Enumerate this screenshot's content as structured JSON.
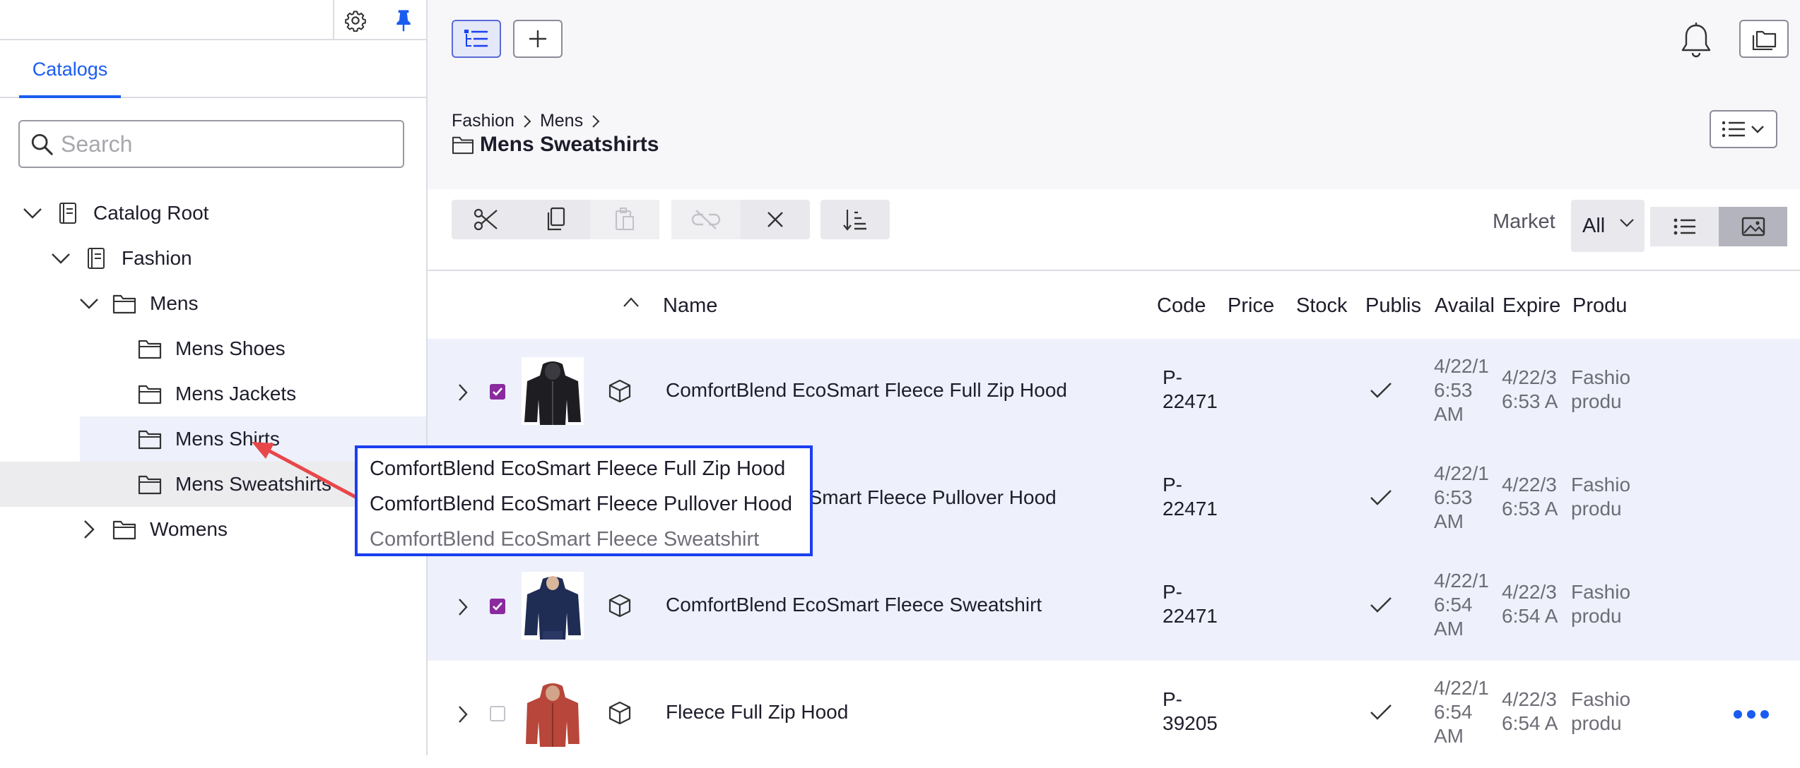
{
  "left_panel": {
    "tab_label": "Catalogs",
    "search_placeholder": "Search",
    "tree": [
      {
        "label": "Catalog Root",
        "expanded": true,
        "icon": "catalog-icon"
      },
      {
        "label": "Fashion",
        "expanded": true,
        "icon": "catalog-icon"
      },
      {
        "label": "Mens",
        "expanded": true,
        "icon": "folder-icon"
      },
      {
        "label": "Mens Shoes",
        "icon": "folder-icon"
      },
      {
        "label": "Mens Jackets",
        "icon": "folder-icon"
      },
      {
        "label": "Mens Shirts",
        "icon": "folder-icon"
      },
      {
        "label": "Mens Sweatshirts",
        "icon": "folder-icon"
      },
      {
        "label": "Womens",
        "expanded": false,
        "icon": "folder-icon"
      }
    ]
  },
  "breadcrumb": [
    "Fashion",
    "Mens"
  ],
  "page_title": "Mens Sweatshirts",
  "market": {
    "label": "Market",
    "value": "All"
  },
  "columns": [
    "Name",
    "Code",
    "Price",
    "Stock",
    "Publis",
    "Availal",
    "Expire",
    "Produ"
  ],
  "rows": [
    {
      "name": "ComfortBlend EcoSmart Fleece Full Zip Hood",
      "code": [
        "P-",
        "22471"
      ],
      "published": true,
      "available": [
        "4/22/1",
        "6:53",
        "AM"
      ],
      "expires": [
        "4/22/3",
        "6:53 A"
      ],
      "product_type": [
        "Fashio",
        "produ"
      ],
      "checked": true
    },
    {
      "name": "ComfortBlend EcoSmart Fleece Pullover Hood",
      "name_visible": "coSmart Fleece Pullover Hood",
      "code": [
        "P-",
        "22471"
      ],
      "published": true,
      "available": [
        "4/22/1",
        "6:53",
        "AM"
      ],
      "expires": [
        "4/22/3",
        "6:53 A"
      ],
      "product_type": [
        "Fashio",
        "produ"
      ],
      "checked": true
    },
    {
      "name": "ComfortBlend EcoSmart Fleece Sweatshirt",
      "code": [
        "P-",
        "22471"
      ],
      "published": true,
      "available": [
        "4/22/1",
        "6:54",
        "AM"
      ],
      "expires": [
        "4/22/3",
        "6:54 A"
      ],
      "product_type": [
        "Fashio",
        "produ"
      ],
      "checked": true
    },
    {
      "name": "Fleece Full Zip Hood",
      "code": [
        "P-",
        "39205"
      ],
      "published": true,
      "available": [
        "4/22/1",
        "6:54",
        "AM"
      ],
      "expires": [
        "4/22/3",
        "6:54 A"
      ],
      "product_type": [
        "Fashio",
        "produ"
      ],
      "checked": false
    }
  ],
  "drag_popup": [
    "ComfortBlend EcoSmart Fleece Full Zip Hood",
    "ComfortBlend EcoSmart Fleece Pullover Hood",
    "ComfortBlend EcoSmart Fleece Sweatshirt"
  ],
  "colors": {
    "accent": "#1a5cf0",
    "checkbox": "#8a2a9e",
    "selected_row": "#eef0fb",
    "popup_border": "#1a3ff0",
    "drag_arrow": "#e8474a",
    "more_dots": "#1a5cf0"
  }
}
